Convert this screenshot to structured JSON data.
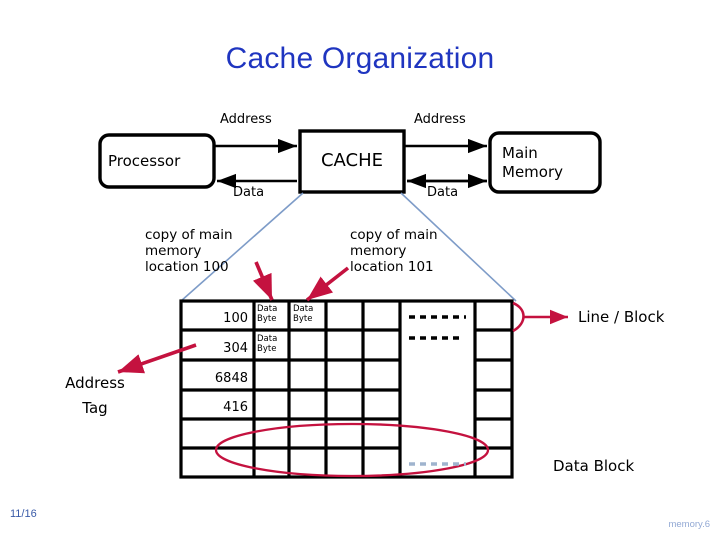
{
  "slide": {
    "title": "Cache Organization",
    "footer": {
      "page": "11/16",
      "note": "memory.6"
    }
  },
  "diagram": {
    "blocks": [
      {
        "id": "processor",
        "label": "Processor"
      },
      {
        "id": "cache",
        "label": "CACHE"
      },
      {
        "id": "main_memory",
        "label": "Main\nMemory",
        "line1": "Main",
        "line2": "Memory"
      }
    ],
    "bus_labels": {
      "address_left": "Address",
      "data_left": "Data",
      "address_right": "Address",
      "data_right": "Data"
    }
  },
  "notes": {
    "left": {
      "line1": "copy of main",
      "line2": "memory",
      "line3": "location 100"
    },
    "right": {
      "line1": "copy of main",
      "line2": "memory",
      "line3": "location 101"
    }
  },
  "labels": {
    "address_tag_line1": "Address",
    "address_tag_line2": "Tag",
    "line_block": "Line / Block",
    "data_block": "Data Block"
  },
  "cache_table": {
    "tag_column": [
      "100",
      "304",
      "6848",
      "416",
      "",
      ""
    ],
    "data_cells": [
      [
        "Data\nByte",
        "Data\nByte",
        "",
        "",
        "",
        ""
      ],
      [
        "Data\nByte",
        "",
        "",
        "",
        "",
        ""
      ],
      [
        "",
        "",
        "",
        "",
        "",
        ""
      ],
      [
        "",
        "",
        "",
        "",
        "",
        ""
      ],
      [
        "",
        "",
        "",
        "",
        "",
        ""
      ],
      [
        "",
        "",
        "",
        "",
        "",
        ""
      ]
    ],
    "databyte_text_line1": "Data",
    "databyte_text_line2": "Byte",
    "ellipsis_rows": [
      "- - - - - - -",
      "- - - - - -"
    ],
    "ellipsis_bottom": "- - - - - - -"
  },
  "colors": {
    "title_blue": "#1F35C0",
    "accent_red": "#C4123F",
    "connector_blue": "#7E9CC8",
    "footer_blue": "#3A5BA8",
    "footer_light": "#93A9D4",
    "outline_black": "#000000",
    "ellipsis_grey_blue": "#9FB4CE"
  }
}
